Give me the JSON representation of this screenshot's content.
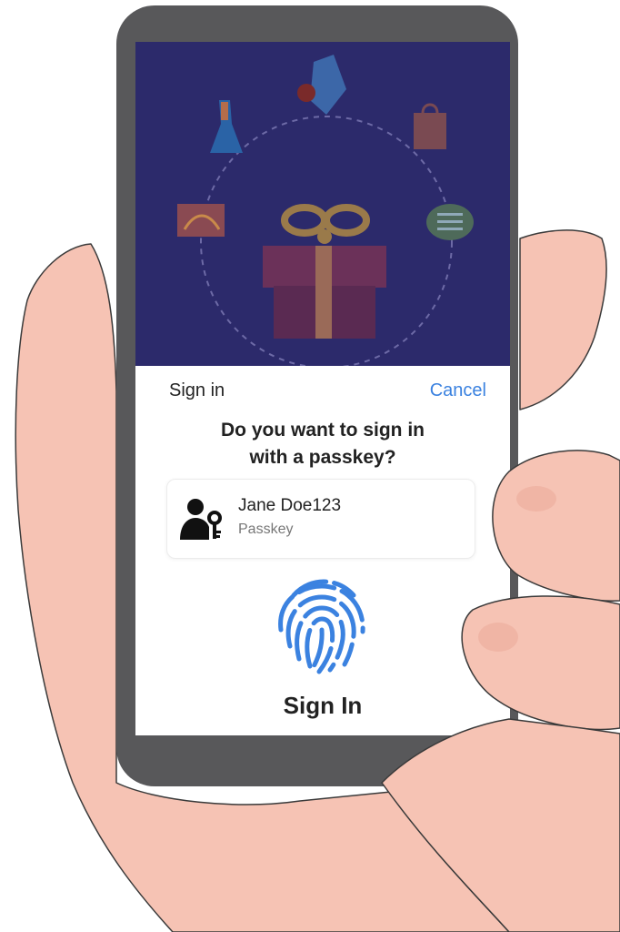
{
  "colors": {
    "accent": "#3b82e0",
    "banner": "#2c2a6b",
    "phone_frame": "#58585a",
    "skin": "#f6c3b4"
  },
  "sheet": {
    "title": "Sign in",
    "cancel_label": "Cancel",
    "prompt_line1": "Do you want to sign in",
    "prompt_line2": "with a passkey?"
  },
  "account": {
    "name": "Jane Doe123",
    "credential_type": "Passkey",
    "icon": "user-key-icon"
  },
  "action": {
    "icon": "fingerprint-icon",
    "label": "Sign In"
  },
  "banner": {
    "icons": [
      "dress-icon",
      "milk-carton-icon",
      "shopping-bag-icon",
      "chat-bubble-icon",
      "card-icon",
      "gift-icon"
    ]
  }
}
